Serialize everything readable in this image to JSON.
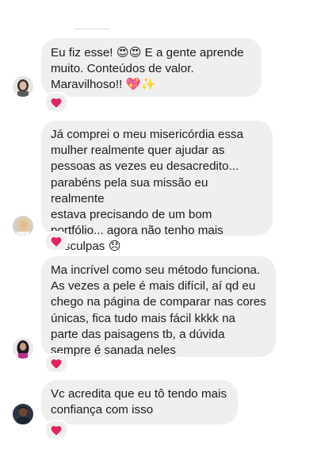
{
  "messages": [
    {
      "text": "Eu fiz esse! 😍😍 E a gente aprende muito. Conteúdos de valor. Maravilhoso!! 💖✨",
      "reaction": "heart-reaction",
      "avatar": "avatar-woman-dark-hair"
    },
    {
      "text": "Já comprei o meu misericórdia essa mulher realmente quer ajudar as pessoas as vezes eu desacredito... parabéns pela sua missão eu realmente estava precisando de um bom portfólio... agora não tenho mais desculpas 😞",
      "reaction": "heart-reaction",
      "avatar": "avatar-woman-blonde"
    },
    {
      "text": "Ma incrível como seu método funciona. As vezes a pele é mais difícil,  aí qd eu chego na página de comparar nas cores únicas, fica tudo mais fácil kkkk na parte das paisagens tb, a dúvida sempre é sanada neles",
      "reaction": "heart-reaction",
      "avatar": "avatar-woman-long-dark-hair"
    },
    {
      "text": "Vc acredita que eu tô tendo mais confiança com isso",
      "reaction": "heart-reaction",
      "avatar": "avatar-man"
    }
  ],
  "colors": {
    "bubble": "#efefef",
    "text": "#1c1c1c",
    "heart": "#e0245e"
  }
}
